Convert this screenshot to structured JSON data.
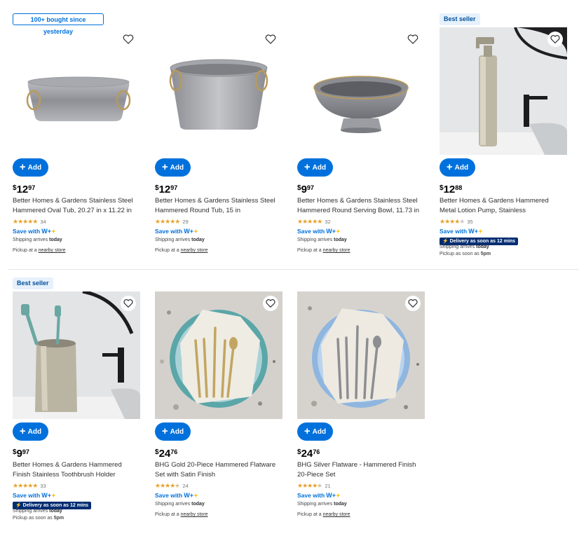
{
  "products": [
    {
      "badge": "100+ bought since yesterday",
      "badge_style": "outline",
      "image": "oval-tub",
      "add_label": "Add",
      "currency": "$",
      "price_dollars": "12",
      "price_cents": "97",
      "title": "Better Homes & Gardens Stainless Steel Hammered Oval Tub, 20.27 in x 11.22 in",
      "rating": 5,
      "rating_count": "34",
      "save_with": "Save with",
      "delivery": "",
      "shipping_label": "Shipping arrives",
      "shipping_time": "today",
      "pickup_label": "Pickup at a",
      "pickup_link": "nearby store"
    },
    {
      "badge": "",
      "image": "round-tub",
      "add_label": "Add",
      "currency": "$",
      "price_dollars": "12",
      "price_cents": "97",
      "title": "Better Homes & Gardens Stainless Steel Hammered Round Tub, 15 in",
      "rating": 5,
      "rating_count": "29",
      "save_with": "Save with",
      "delivery": "",
      "shipping_label": "Shipping arrives",
      "shipping_time": "today",
      "pickup_label": "Pickup at a",
      "pickup_link": "nearby store"
    },
    {
      "badge": "",
      "image": "serving-bowl",
      "add_label": "Add",
      "currency": "$",
      "price_dollars": "9",
      "price_cents": "97",
      "title": "Better Homes & Gardens Stainless Steel Hammered Round Serving Bowl, 11.73 in",
      "rating": 5,
      "rating_count": "32",
      "save_with": "Save with",
      "delivery": "",
      "shipping_label": "Shipping arrives",
      "shipping_time": "today",
      "pickup_label": "Pickup at a",
      "pickup_link": "nearby store"
    },
    {
      "badge": "Best seller",
      "badge_style": "blue",
      "image": "lotion-pump",
      "add_label": "Add",
      "currency": "$",
      "price_dollars": "12",
      "price_cents": "88",
      "title": "Better Homes & Gardens Hammered Metal Lotion Pump, Stainless",
      "rating": 4,
      "rating_count": "35",
      "save_with": "Save with",
      "delivery": "Delivery as soon as 12 mins",
      "shipping_label": "Shipping arrives",
      "shipping_time": "today",
      "pickup_label": "Pickup as soon as",
      "pickup_time": "5pm"
    },
    {
      "badge": "Best seller",
      "badge_style": "blue",
      "image": "toothbrush-holder",
      "add_label": "Add",
      "currency": "$",
      "price_dollars": "9",
      "price_cents": "97",
      "title": "Better Homes & Gardens Hammered Finish Stainless Toothbrush Holder",
      "rating": 5,
      "rating_count": "33",
      "save_with": "Save with",
      "delivery": "Delivery as soon as 12 mins",
      "shipping_label": "Shipping arrives",
      "shipping_time": "today",
      "pickup_label": "Pickup as soon as",
      "pickup_time": "5pm"
    },
    {
      "badge": "",
      "image": "gold-flatware",
      "add_label": "Add",
      "currency": "$",
      "price_dollars": "24",
      "price_cents": "76",
      "title": "BHG Gold 20-Piece Hammered Flatware Set with Satin Finish",
      "rating": 4.5,
      "rating_count": "24",
      "save_with": "Save with",
      "delivery": "",
      "shipping_label": "Shipping arrives",
      "shipping_time": "today",
      "pickup_label": "Pickup at a",
      "pickup_link": "nearby store"
    },
    {
      "badge": "",
      "image": "silver-flatware",
      "add_label": "Add",
      "currency": "$",
      "price_dollars": "24",
      "price_cents": "76",
      "title": "BHG Silver Flatware - Hammered Finish 20-Piece Set",
      "rating": 4.5,
      "rating_count": "21",
      "save_with": "Save with",
      "delivery": "",
      "shipping_label": "Shipping arrives",
      "shipping_time": "today",
      "pickup_label": "Pickup at a",
      "pickup_link": "nearby store"
    }
  ],
  "walmart_plus": "W+",
  "colors": {
    "accent": "#0071dc",
    "star": "#e7a12b",
    "delivery_bg": "#002d72",
    "spark": "#ffc220"
  }
}
